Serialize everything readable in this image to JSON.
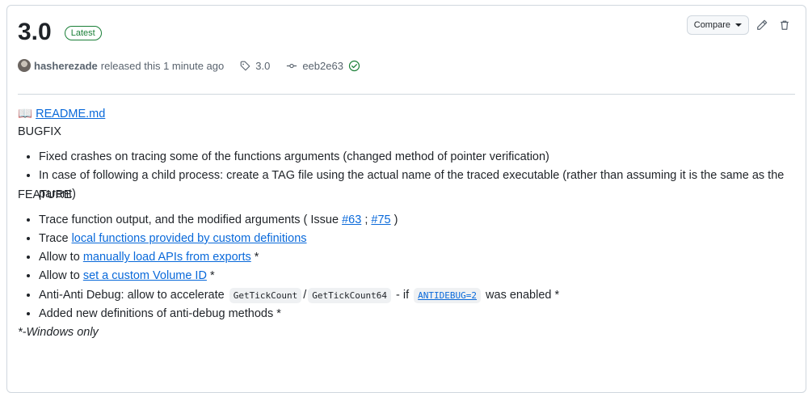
{
  "release": {
    "title": "3.0",
    "badge": "Latest",
    "compare_label": "Compare",
    "author": "hasherezade",
    "released_text": "released this 1 minute ago",
    "tag": "3.0",
    "commit": "eeb2e63"
  },
  "body": {
    "readme_emoji": "📖",
    "readme_link": "README.md",
    "bugfix_heading": "BUGFIX",
    "bugfix_items": [
      "Fixed crashes on tracing some of the functions arguments (changed method of pointer verification)",
      "In case of following a child process: create a TAG file using the actual name of the traced executable (rather than assuming it is the same as the parent)"
    ],
    "feature_heading": "FEATURE",
    "feature": {
      "item1_prefix": "Trace function output, and the modified arguments ( Issue",
      "item1_link1": "#63",
      "item1_sep": ";",
      "item1_link2": "#75",
      "item1_suffix": ")",
      "item2_prefix": "Trace",
      "item2_link": "local functions provided by custom definitions",
      "item3_prefix": "Allow to",
      "item3_link": "manually load APIs from exports",
      "item3_suffix": "*",
      "item4_prefix": "Allow to",
      "item4_link": "set a custom Volume ID",
      "item4_suffix": "*",
      "item5_prefix": "Anti-Anti Debug: allow to accelerate",
      "item5_code1": "GetTickCount",
      "item5_sep": "/",
      "item5_code2": "GetTickCount64",
      "item5_mid": "- if",
      "item5_code3": "ANTIDEBUG=2",
      "item5_suffix": "was enabled *",
      "item6": "Added new definitions of anti-debug methods *"
    },
    "footnote": "*-Windows only"
  },
  "colors": {
    "accent_link": "#0969da",
    "latest_badge": "#1a7f37",
    "verified_check": "#1a7f37",
    "border": "#d0d7de"
  },
  "icons": [
    "pencil-icon",
    "trash-icon",
    "tag-icon",
    "commit-icon",
    "verified-check-icon",
    "caret-down-icon"
  ]
}
